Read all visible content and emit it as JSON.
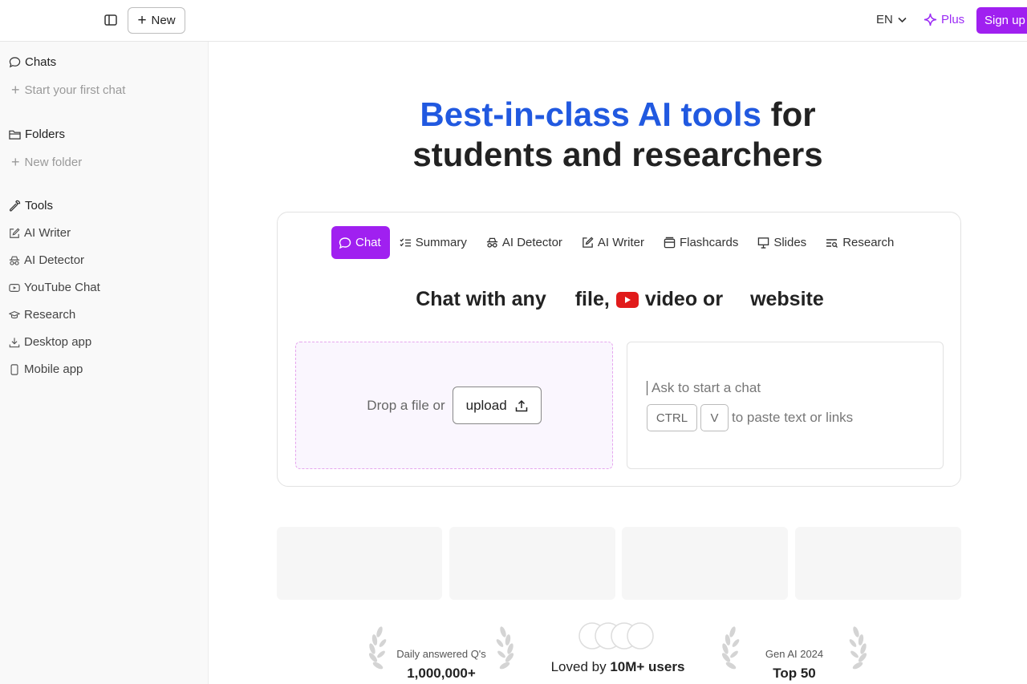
{
  "topbar": {
    "new_label": "New",
    "lang": "EN",
    "plus_label": "Plus",
    "signup_label": "Sign up",
    "accent": "#a020f0"
  },
  "sidebar": {
    "chats_heading": "Chats",
    "start_chat": "Start your first chat",
    "folders_heading": "Folders",
    "new_folder": "New folder",
    "tools_heading": "Tools",
    "items": [
      {
        "label": "AI Writer",
        "icon": "pencil-square-icon"
      },
      {
        "label": "AI Detector",
        "icon": "spy-icon"
      },
      {
        "label": "YouTube Chat",
        "icon": "youtube-icon"
      },
      {
        "label": "Research",
        "icon": "graduation-cap-icon"
      },
      {
        "label": "Desktop app",
        "icon": "download-icon"
      },
      {
        "label": "Mobile app",
        "icon": "phone-icon"
      }
    ]
  },
  "hero": {
    "highlight": "Best-in-class AI tools",
    "rest1": " for",
    "line2": "students and researchers",
    "highlight_color": "#2159e0"
  },
  "tabs": [
    {
      "label": "Chat",
      "icon": "chat-bubble-icon"
    },
    {
      "label": "Summary",
      "icon": "list-check-icon"
    },
    {
      "label": "AI Detector",
      "icon": "spy-icon"
    },
    {
      "label": "AI Writer",
      "icon": "pencil-square-icon"
    },
    {
      "label": "Flashcards",
      "icon": "cards-icon"
    },
    {
      "label": "Slides",
      "icon": "presentation-icon"
    },
    {
      "label": "Research",
      "icon": "search-list-icon"
    }
  ],
  "subtitle": {
    "part1": "Chat with any",
    "part2": "file,",
    "part3": "video or",
    "part4": "website"
  },
  "drop": {
    "text": "Drop a file or",
    "upload_label": "upload"
  },
  "ask": {
    "placeholder": "Ask to start a chat",
    "key1": "CTRL",
    "key2": "V",
    "paste_text": "to paste text or links"
  },
  "badges": {
    "left_label": "Daily answered Q's",
    "left_value": "1,000,000+",
    "middle_prefix": "Loved by ",
    "middle_bold": "10M+ users",
    "right_label": "Gen AI 2024",
    "right_value": "Top 50"
  }
}
